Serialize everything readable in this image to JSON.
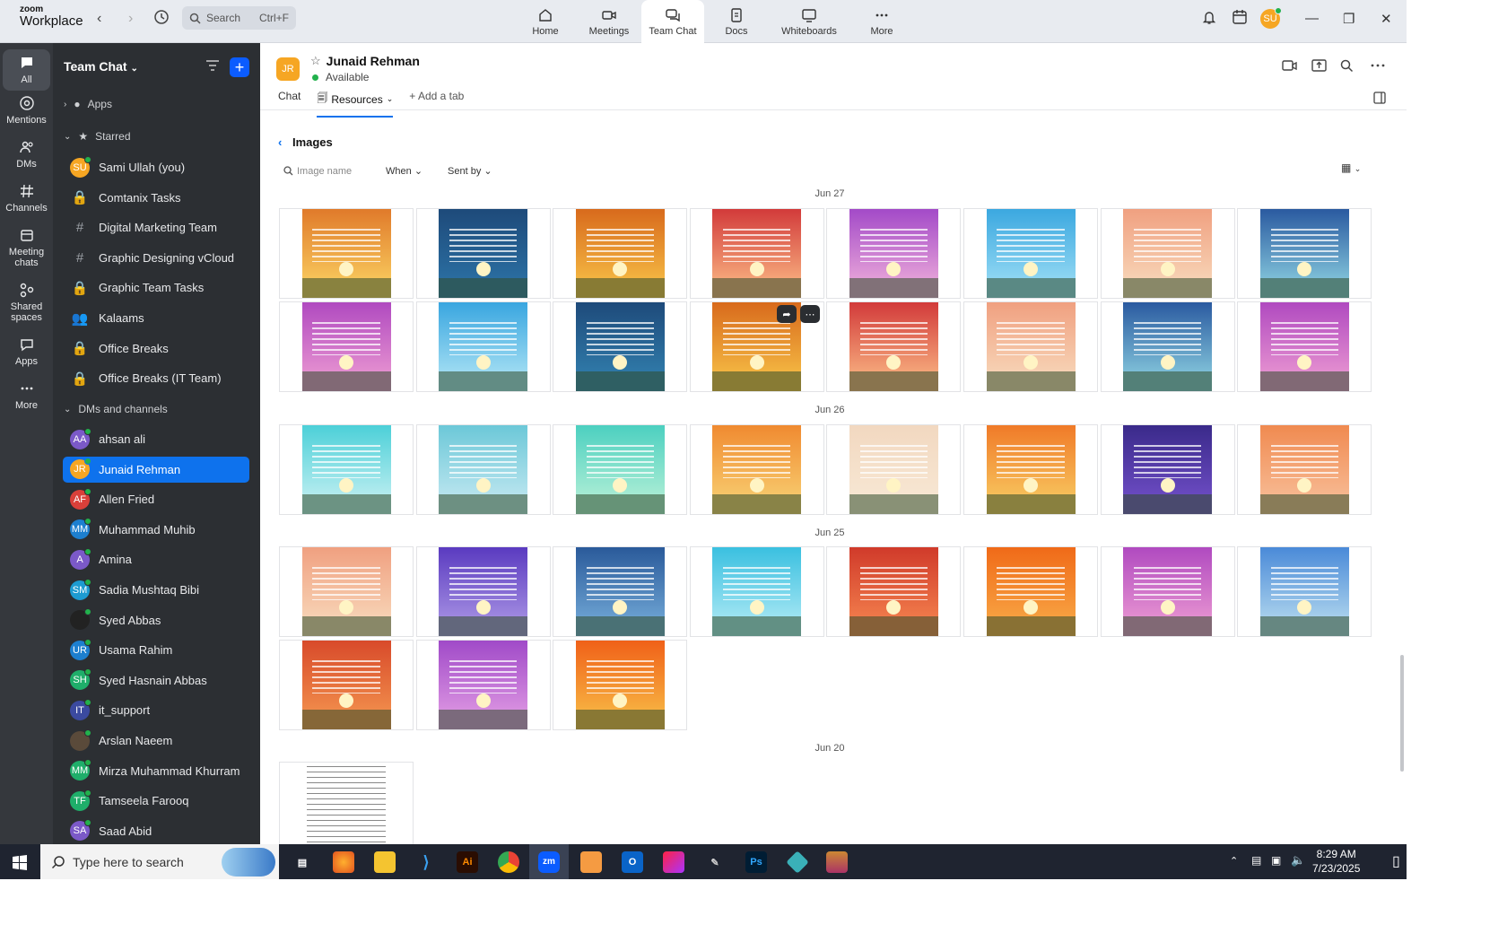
{
  "topbar": {
    "logo_line1": "zoom",
    "logo_line2": "Workplace",
    "search_placeholder": "Search",
    "search_shortcut": "Ctrl+F",
    "nav": [
      {
        "label": "Home",
        "icon": "home-icon"
      },
      {
        "label": "Meetings",
        "icon": "video-icon"
      },
      {
        "label": "Team Chat",
        "icon": "chat-icon"
      },
      {
        "label": "Docs",
        "icon": "docs-icon"
      },
      {
        "label": "Whiteboards",
        "icon": "whiteboard-icon"
      },
      {
        "label": "More",
        "icon": "more-icon"
      }
    ],
    "user_initials": "SU"
  },
  "rail": [
    {
      "label": "All",
      "icon": "chat-bubble-icon"
    },
    {
      "label": "Mentions",
      "icon": "at-icon"
    },
    {
      "label": "DMs",
      "icon": "people-icon"
    },
    {
      "label": "Channels",
      "icon": "hash-icon"
    },
    {
      "label": "Meeting chats",
      "icon": "calendar-icon"
    },
    {
      "label": "Shared spaces",
      "icon": "shared-icon"
    },
    {
      "label": "Apps",
      "icon": "apps-icon"
    },
    {
      "label": "More",
      "icon": "more-icon"
    }
  ],
  "sidebar": {
    "title": "Team Chat",
    "apps_label": "Apps",
    "starred_label": "Starred",
    "dms_label": "DMs and channels",
    "starred": [
      {
        "name": "Sami Ullah (you)",
        "initials": "SU",
        "color": "#f6a623",
        "type": "avatar"
      },
      {
        "name": "Comtanix Tasks",
        "type": "lock"
      },
      {
        "name": "Digital Marketing Team",
        "type": "hash"
      },
      {
        "name": "Graphic Designing vCloud",
        "type": "hash"
      },
      {
        "name": "Graphic Team Tasks",
        "type": "lock"
      },
      {
        "name": "Kalaams",
        "type": "group"
      },
      {
        "name": "Office Breaks",
        "type": "lock"
      },
      {
        "name": "Office Breaks (IT Team)",
        "type": "lock"
      }
    ],
    "dms": [
      {
        "name": "ahsan ali",
        "initials": "AA",
        "color": "#7b59c8"
      },
      {
        "name": "Junaid Rehman",
        "initials": "JR",
        "color": "#f6a623"
      },
      {
        "name": "Allen Fried",
        "initials": "AF",
        "color": "#d9403a"
      },
      {
        "name": "Muhammad Muhib",
        "initials": "MM",
        "color": "#1d7fcf"
      },
      {
        "name": "Amina",
        "initials": "A",
        "color": "#7b59c8"
      },
      {
        "name": "Sadia Mushtaq Bibi",
        "initials": "SM",
        "color": "#1d9bd1"
      },
      {
        "name": "Syed Abbas",
        "initials": "",
        "color": "#222"
      },
      {
        "name": "Usama Rahim",
        "initials": "UR",
        "color": "#1d7fcf"
      },
      {
        "name": "Syed Hasnain Abbas",
        "initials": "SH",
        "color": "#1fae6a"
      },
      {
        "name": "it_support",
        "initials": "IT",
        "color": "#3b4aa0"
      },
      {
        "name": "Arslan Naeem",
        "initials": "",
        "color": "#5a4a3a"
      },
      {
        "name": "Mirza Muhammad Khurram",
        "initials": "MM",
        "color": "#1fae6a"
      },
      {
        "name": "Tamseela Farooq",
        "initials": "TF",
        "color": "#1fae6a"
      },
      {
        "name": "Saad Abid",
        "initials": "SA",
        "color": "#7b59c8"
      }
    ]
  },
  "chat": {
    "initials": "JR",
    "name": "Junaid Rehman",
    "status": "Available",
    "tabs": [
      "Chat",
      "Resources",
      "Add a tab"
    ],
    "section_title": "Images",
    "search_placeholder": "Image name",
    "filter_when": "When",
    "filter_sent": "Sent by",
    "dates": [
      "Jun 27",
      "Jun 26",
      "Jun 25",
      "Jun 20"
    ]
  },
  "thumb_colors": {
    "jun27": [
      [
        "#e07a2a",
        "#f7c55a"
      ],
      [
        "#1e4a7a",
        "#2a6da0"
      ],
      [
        "#d86a1c",
        "#f3b541"
      ],
      [
        "#d23a3a",
        "#f5a77a"
      ],
      [
        "#a34ac8",
        "#e4a0d8"
      ],
      [
        "#3ba8e0",
        "#8fd6f2"
      ],
      [
        "#f0a080",
        "#f7d2b4"
      ],
      [
        "#2a5aa0",
        "#7fc0d8"
      ],
      [
        "#b04ac0",
        "#e48fd0"
      ],
      [
        "#39a6e0",
        "#9fdcf2"
      ],
      [
        "#1e4a7a",
        "#2f79a8"
      ],
      [
        "#d86a1c",
        "#f3b541"
      ],
      [
        "#d23a3a",
        "#f5a77a"
      ],
      [
        "#f0a080",
        "#f7d2b4"
      ],
      [
        "#2a5aa0",
        "#7fc0d8"
      ],
      [
        "#b04ac0",
        "#e48fd0"
      ]
    ],
    "jun26": [
      [
        "#4cd0d8",
        "#b6ecef"
      ],
      [
        "#6cc8d8",
        "#b8e4ee"
      ],
      [
        "#4cd0c0",
        "#a8ecd4"
      ],
      [
        "#f08a30",
        "#f7c76a"
      ],
      [
        "#f2d8c0",
        "#f7e6d2"
      ],
      [
        "#f07a28",
        "#f7c05a"
      ],
      [
        "#3a2a8a",
        "#6a4ac0"
      ],
      [
        "#f08a50",
        "#f7b890"
      ]
    ],
    "jun25": [
      [
        "#f0a080",
        "#f7d2b4"
      ],
      [
        "#5a3ac0",
        "#a08ae0"
      ],
      [
        "#2a5a9a",
        "#6aa0d0"
      ],
      [
        "#3ac0e0",
        "#9fe4f2"
      ],
      [
        "#d03a2a",
        "#f07a4a"
      ],
      [
        "#f06a18",
        "#f7a040"
      ],
      [
        "#b04ac0",
        "#e48fd0"
      ],
      [
        "#4a8ad8",
        "#a8d0ec"
      ],
      [
        "#d84a2a",
        "#f08a4a"
      ],
      [
        "#a04ac8",
        "#d890e0"
      ],
      [
        "#f06018",
        "#f7b040"
      ]
    ]
  },
  "taskbar": {
    "search_placeholder": "Type here to search",
    "time": "8:29 AM",
    "date": "7/23/2025"
  }
}
